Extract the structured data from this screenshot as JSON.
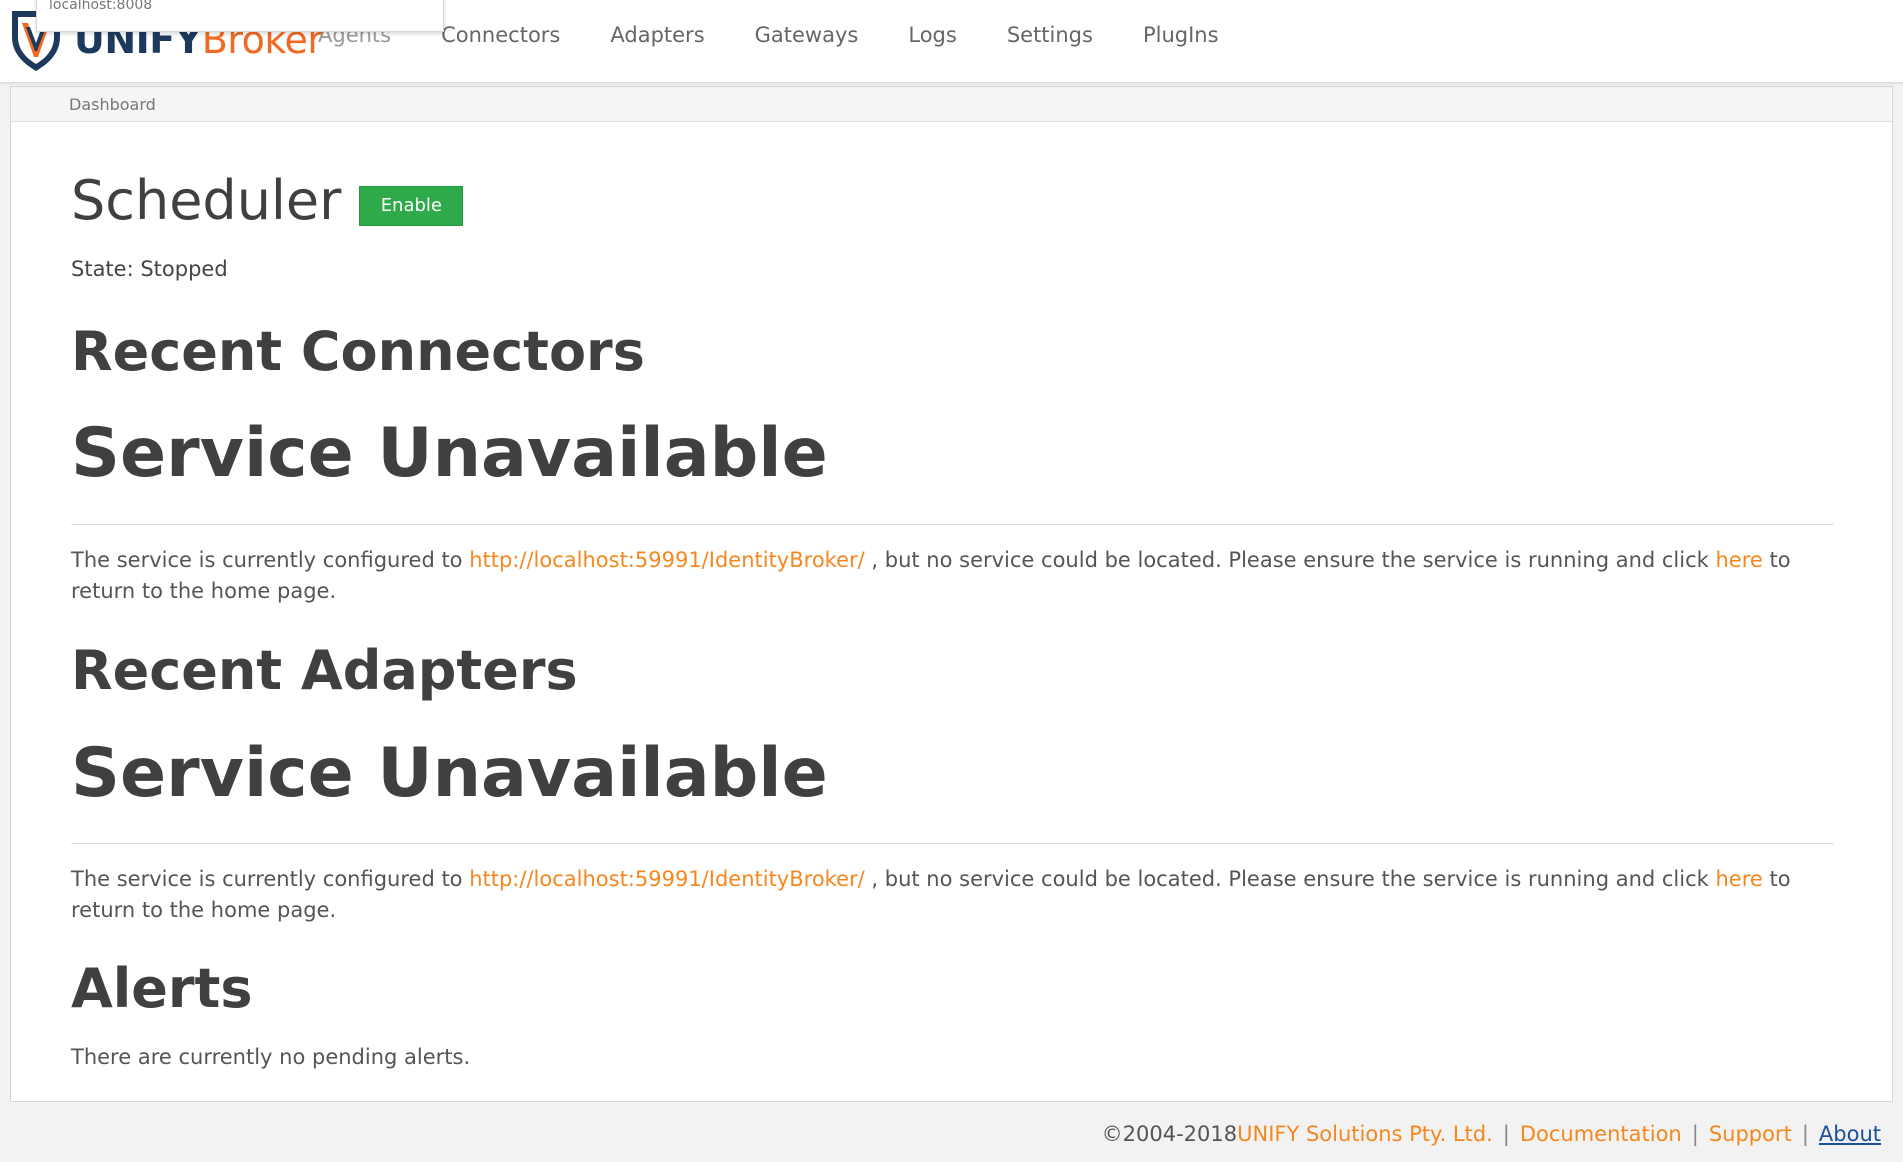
{
  "tooltip": {
    "url": "localhost:8008"
  },
  "brand": {
    "unify": "UNIFY",
    "broker": "Broker"
  },
  "nav": {
    "items": [
      "Agents",
      "Connectors",
      "Adapters",
      "Gateways",
      "Logs",
      "Settings",
      "PlugIns"
    ]
  },
  "breadcrumb": "Dashboard",
  "scheduler": {
    "title": "Scheduler",
    "enable_label": "Enable",
    "state": "State: Stopped"
  },
  "connectors": {
    "title": "Recent Connectors",
    "unavailable_title": "Service Unavailable",
    "msg_pre": "The service is currently configured to ",
    "url": "http://localhost:59991/IdentityBroker/",
    "msg_mid": " , but no service could be located. Please ensure the service is running and click ",
    "here": "here",
    "msg_post": " to return to the home page."
  },
  "adapters": {
    "title": "Recent Adapters",
    "unavailable_title": "Service Unavailable",
    "msg_pre": "The service is currently configured to ",
    "url": "http://localhost:59991/IdentityBroker/",
    "msg_mid": " , but no service could be located. Please ensure the service is running and click ",
    "here": "here",
    "msg_post": " to return to the home page."
  },
  "alerts": {
    "title": "Alerts",
    "message": "There are currently no pending alerts."
  },
  "footer": {
    "copyright": "©2004-2018 ",
    "org": "UNIFY Solutions Pty. Ltd.",
    "sep": "|",
    "documentation": "Documentation",
    "support": "Support",
    "about": "About"
  },
  "colors": {
    "accent_orange": "#f5871f",
    "enable_green": "#2eaa4a",
    "brand_navy": "#1d3a5c",
    "link_blue": "#1a4f9c"
  },
  "icons": [
    "unify-shield-logo-icon"
  ]
}
